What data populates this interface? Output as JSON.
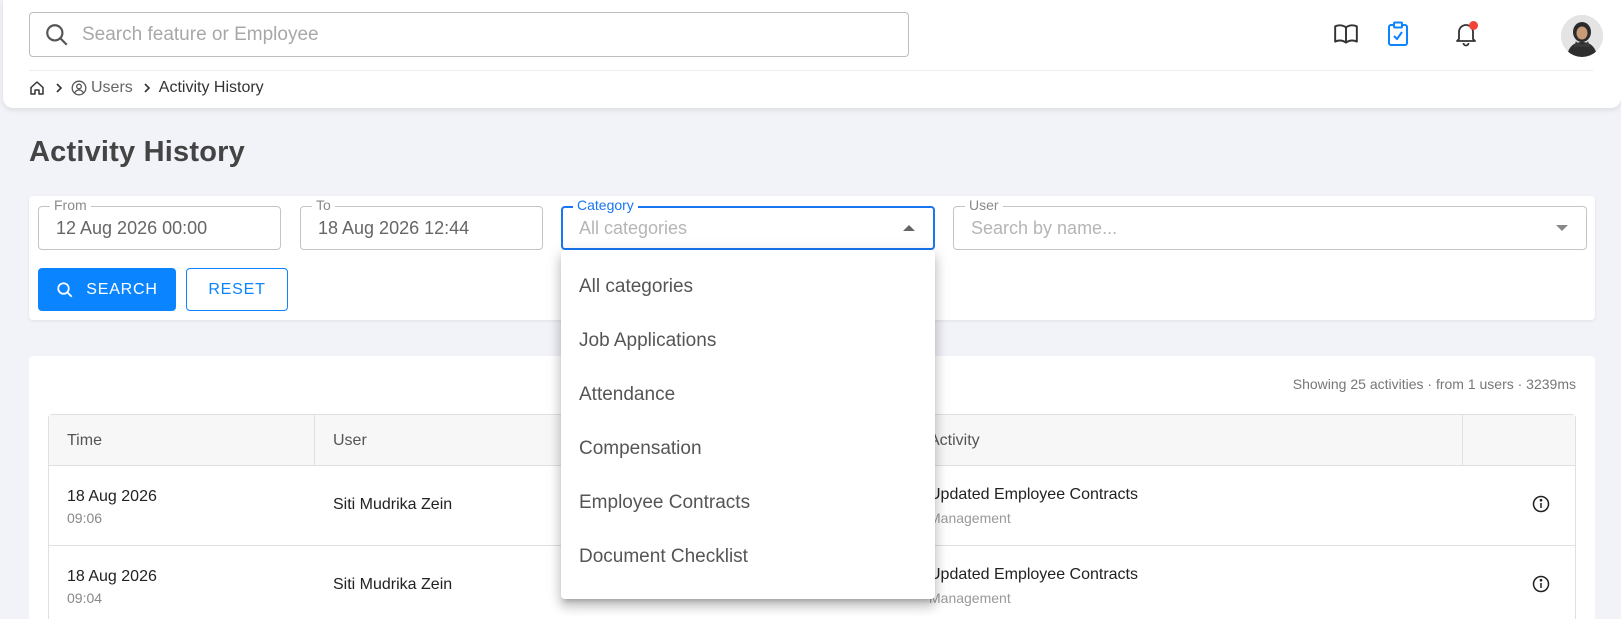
{
  "header": {
    "search_placeholder": "Search feature or Employee"
  },
  "breadcrumb": {
    "users": "Users",
    "current": "Activity History"
  },
  "page": {
    "title": "Activity History"
  },
  "filters": {
    "from_label": "From",
    "from_value": "12 Aug 2026 00:00",
    "to_label": "To",
    "to_value": "18 Aug 2026 12:44",
    "category_label": "Category",
    "category_placeholder": "All categories",
    "user_label": "User",
    "user_placeholder": "Search by name...",
    "search_button": "SEARCH",
    "reset_button": "RESET"
  },
  "category_options": [
    "All categories",
    "Job Applications",
    "Attendance",
    "Compensation",
    "Employee Contracts",
    "Document Checklist"
  ],
  "results": {
    "summary": "Showing 25 activities · from 1 users · 3239ms",
    "columns": {
      "time": "Time",
      "user": "User",
      "activity": "Activity"
    },
    "rows": [
      {
        "date": "18 Aug 2026",
        "time": "09:06",
        "user": "Siti Mudrika Zein",
        "activity": "Updated Employee Contracts",
        "module": "Management"
      },
      {
        "date": "18 Aug 2026",
        "time": "09:04",
        "user": "Siti Mudrika Zein",
        "activity": "Updated Employee Contracts",
        "module": "Management"
      }
    ]
  },
  "colors": {
    "primary": "#0a84ff",
    "focus": "#1976f2",
    "notification_dot": "#f44336",
    "background": "#f2f3f8"
  },
  "icons": [
    "search-icon",
    "book-icon",
    "clipboard-check-icon",
    "bell-icon",
    "home-icon",
    "chevron-right-icon",
    "user-circle-icon",
    "caret-up-icon",
    "caret-down-icon",
    "info-icon"
  ]
}
